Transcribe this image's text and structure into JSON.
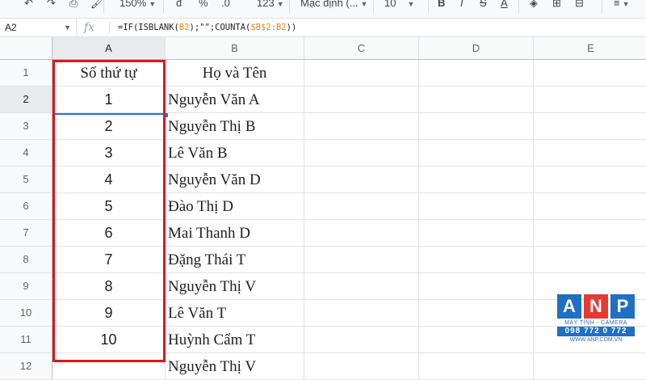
{
  "toolbar": {
    "zoom": "150%",
    "currency": "đ",
    "percent": "%",
    "decimals": ".0",
    "more_formats": "123",
    "font": "Mặc định (...",
    "font_size": "10",
    "bold": "B",
    "italic": "I",
    "strike": "S",
    "text_color": "A"
  },
  "formula_bar": {
    "cell_ref": "A2",
    "fx_label": "fx",
    "formula_prefix": "=IF(ISBLANK(",
    "formula_ref1": "B2",
    "formula_mid": ");\"\";COUNTA(",
    "formula_ref2": "$B$2:B2",
    "formula_suffix": "))"
  },
  "columns": [
    "A",
    "B",
    "C",
    "D",
    "E"
  ],
  "rows": [
    "1",
    "2",
    "3",
    "4",
    "5",
    "6",
    "7",
    "8",
    "9",
    "10",
    "11",
    "12"
  ],
  "header": {
    "col_a": "Số thứ tự",
    "col_b": "Họ và Tên"
  },
  "data": [
    {
      "stt": "1",
      "name": "Nguyễn Văn A"
    },
    {
      "stt": "2",
      "name": "Nguyễn Thị B"
    },
    {
      "stt": "3",
      "name": "Lê Văn B"
    },
    {
      "stt": "4",
      "name": "Nguyễn Văn D"
    },
    {
      "stt": "5",
      "name": "Đào Thị D"
    },
    {
      "stt": "6",
      "name": "Mai Thanh D"
    },
    {
      "stt": "7",
      "name": "Đặng Thái T"
    },
    {
      "stt": "8",
      "name": "Nguyễn Thị V"
    },
    {
      "stt": "9",
      "name": "Lê Văn T"
    },
    {
      "stt": "10",
      "name": "Huỳnh Cẩm T"
    },
    {
      "stt": "",
      "name": "Nguyễn Thị V"
    }
  ],
  "logo": {
    "letters": [
      "A",
      "N",
      "P"
    ],
    "tagline": "MÁY TÍNH - CAMERA",
    "phone": "098 772 0 772",
    "website": "WWW.ANP.COM.VN"
  },
  "colors": {
    "highlight": "#e0141e",
    "selection": "#1a73e8",
    "logo_blue": "#1f6fc4",
    "logo_red": "#e53935"
  }
}
